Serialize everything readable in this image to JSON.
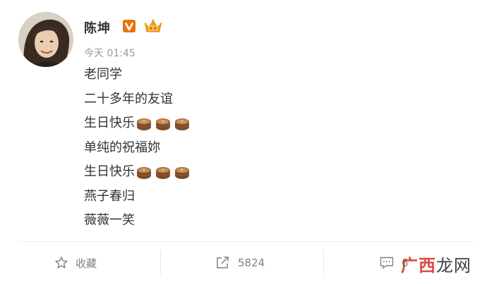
{
  "post": {
    "username": "陈坤",
    "time": "今天 01:45",
    "lines": [
      {
        "text": "老同学",
        "cakes": 0
      },
      {
        "text": "二十多年的友谊",
        "cakes": 0
      },
      {
        "text": "生日快乐",
        "cakes": 3
      },
      {
        "text": "单纯的祝福妳",
        "cakes": 0
      },
      {
        "text": "生日快乐",
        "cakes": 3
      },
      {
        "text": "燕子春归",
        "cakes": 0
      },
      {
        "text": "薇薇一笑",
        "cakes": 0
      }
    ]
  },
  "icons": {
    "verified": "verified-v-icon",
    "member": "member-crown-icon",
    "cake": "cake-emoji-icon",
    "favorite": "star-icon",
    "share": "share-icon",
    "comment": "comment-icon"
  },
  "actions": {
    "favorite_label": "收藏",
    "share_count": "5824",
    "comment_count": "6"
  },
  "watermark": {
    "part1": "广西",
    "part2": "龙网"
  },
  "colors": {
    "text": "#333333",
    "muted": "#999999",
    "action": "#808080",
    "verified": "#e8740f",
    "watermark": "#d8382d"
  }
}
